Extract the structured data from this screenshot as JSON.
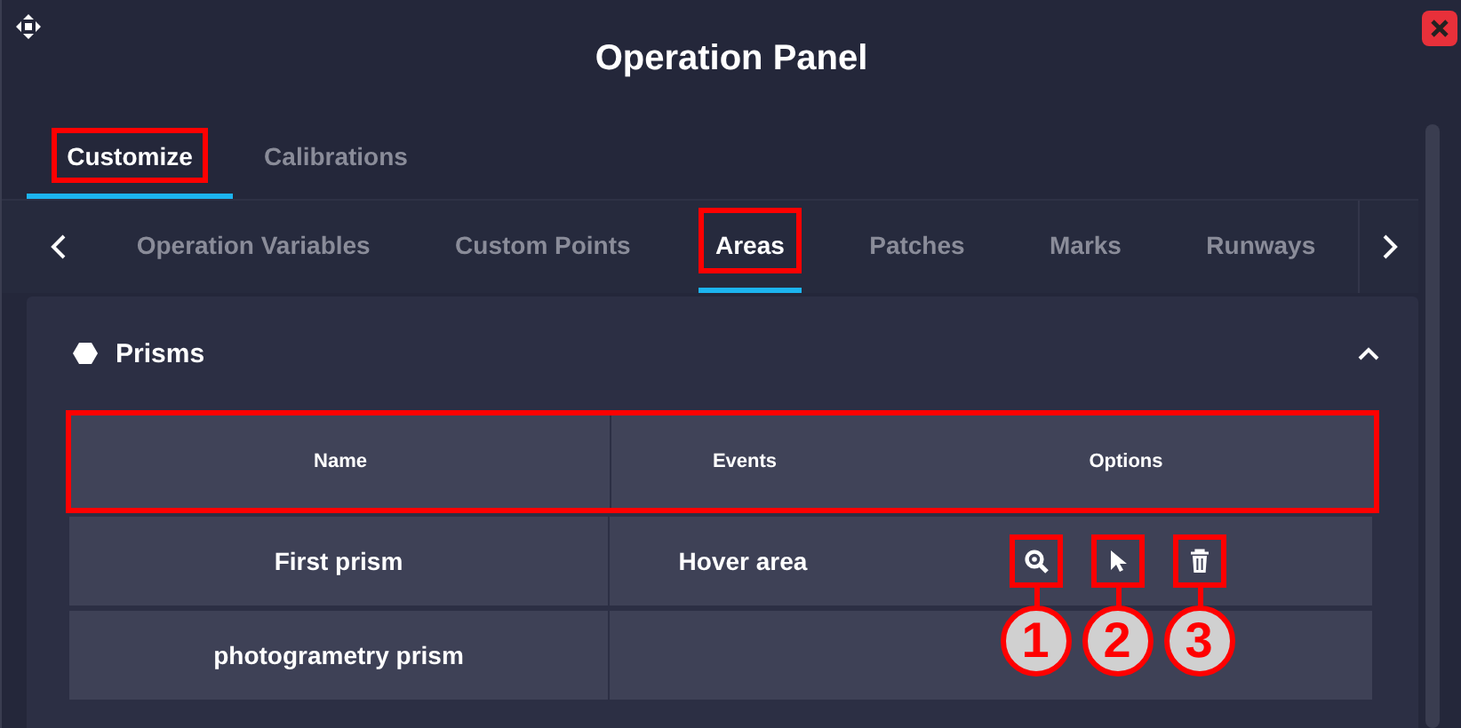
{
  "window": {
    "title": "Operation Panel"
  },
  "tabs": [
    {
      "label": "Customize",
      "selected": true,
      "highlighted": true
    },
    {
      "label": "Calibrations",
      "selected": false,
      "highlighted": false
    }
  ],
  "subtabs": [
    {
      "label": "Operation Variables",
      "selected": false,
      "highlighted": false
    },
    {
      "label": "Custom Points",
      "selected": false,
      "highlighted": false
    },
    {
      "label": "Areas",
      "selected": true,
      "highlighted": true
    },
    {
      "label": "Patches",
      "selected": false,
      "highlighted": false
    },
    {
      "label": "Marks",
      "selected": false,
      "highlighted": false
    },
    {
      "label": "Runways",
      "selected": false,
      "highlighted": false
    }
  ],
  "section": {
    "title": "Prisms",
    "expanded": true,
    "table": {
      "columns": [
        "Name",
        "Events",
        "Options"
      ],
      "header_highlighted": true,
      "rows": [
        {
          "name": "First prism",
          "events": "Hover area",
          "options": [
            {
              "kind": "zoom",
              "highlighted": true,
              "callout": "1"
            },
            {
              "kind": "pointer",
              "highlighted": true,
              "callout": "2"
            },
            {
              "kind": "delete",
              "highlighted": true,
              "callout": "3"
            }
          ]
        },
        {
          "name": "photogrametry prism",
          "events": "",
          "options": []
        }
      ]
    }
  }
}
